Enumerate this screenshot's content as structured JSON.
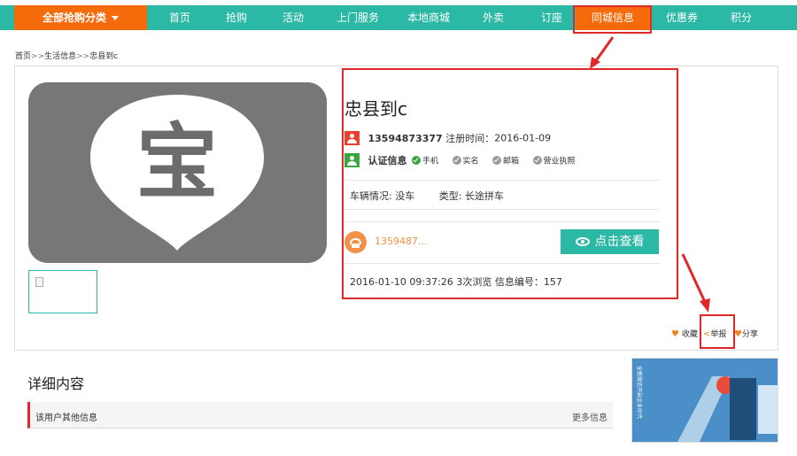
{
  "nav": {
    "category": "全部抢购分类",
    "items": [
      "首页",
      "抢购",
      "活动",
      "上门服务",
      "本地商城",
      "外卖",
      "订座",
      "同城信息",
      "优惠券",
      "积分"
    ],
    "active_index": 7,
    "colors": {
      "bar": "#2bb8a4",
      "accent": "#f56a0a"
    }
  },
  "breadcrumb": [
    "首页",
    "生活信息",
    "忠县到c"
  ],
  "breadcrumb_sep": ">>",
  "post": {
    "title": "忠县到c",
    "logo_char": "宝",
    "phone_full": "13594873377",
    "reg_label": "注册时间：",
    "reg_date": "2016-01-09",
    "verify_label": "认证信息",
    "verify_items": [
      {
        "label": "手机",
        "verified": true
      },
      {
        "label": "实名",
        "verified": false
      },
      {
        "label": "邮箱",
        "verified": false
      },
      {
        "label": "营业执照",
        "verified": false
      }
    ],
    "vehicle_label": "车辆情况:",
    "vehicle_value": "没车",
    "type_label": "类型:",
    "type_value": "长途拼车",
    "phone_masked": "1359487...",
    "view_button": "点击查看",
    "meta": "2016-01-10 09:37:26 3次浏览 信息编号：157"
  },
  "actions": {
    "favorite": "收藏",
    "report": "举报",
    "share": "分享"
  },
  "details": {
    "title": "详细内容",
    "other_label": "该用户其他信息",
    "more": "更多信息"
  },
  "ad": {
    "text": "全新微信开启企业时代"
  }
}
